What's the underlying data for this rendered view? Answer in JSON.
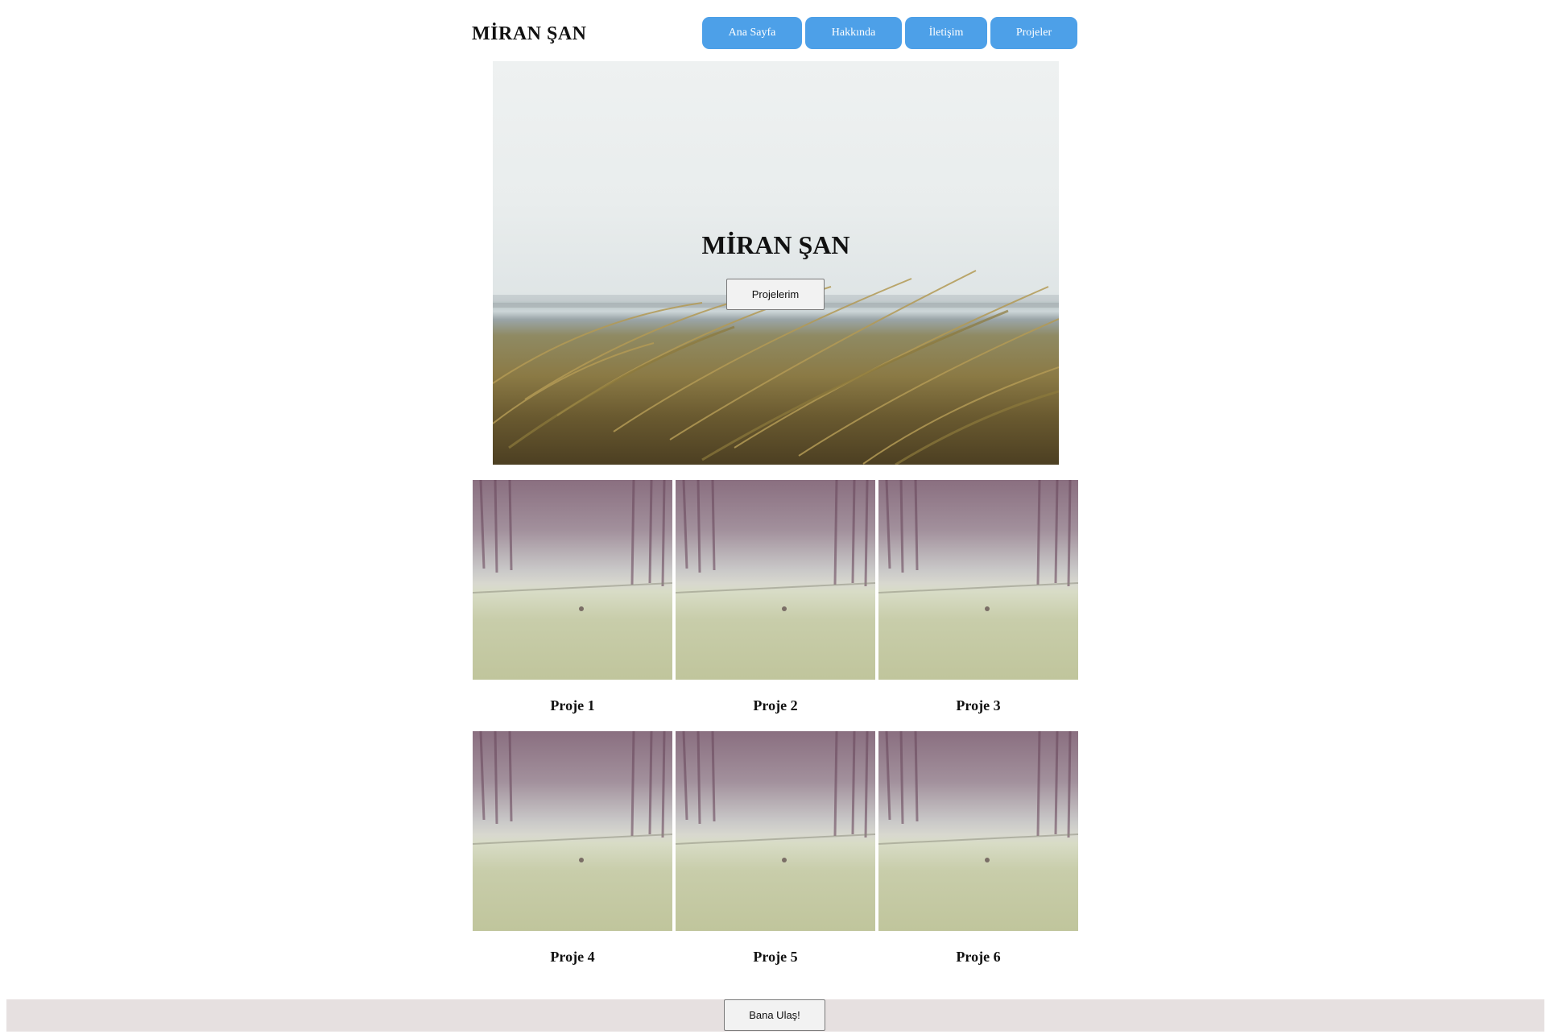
{
  "header": {
    "brand": "MİRAN ŞAN",
    "nav": [
      {
        "label": "Ana Sayfa"
      },
      {
        "label": "Hakkında"
      },
      {
        "label": "İletişim"
      },
      {
        "label": "Projeler"
      }
    ]
  },
  "hero": {
    "title": "MİRAN ŞAN",
    "button_label": "Projelerim"
  },
  "projects": [
    {
      "label": "Proje 1"
    },
    {
      "label": "Proje 2"
    },
    {
      "label": "Proje 3"
    },
    {
      "label": "Proje 4"
    },
    {
      "label": "Proje 5"
    },
    {
      "label": "Proje 6"
    }
  ],
  "footer": {
    "button_label": "Bana Ulaş!"
  },
  "colors": {
    "nav_button": "#4da0e8",
    "footer_bg": "#e6e0e0"
  }
}
